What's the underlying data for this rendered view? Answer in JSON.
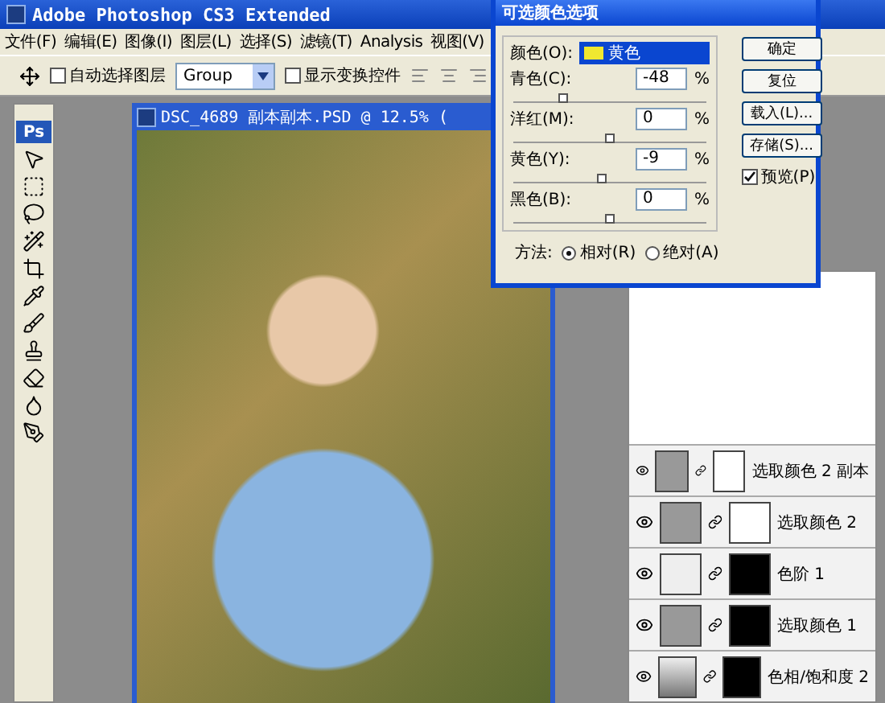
{
  "window": {
    "title": "Adobe Photoshop CS3 Extended"
  },
  "menu": [
    "文件(F)",
    "编辑(E)",
    "图像(I)",
    "图层(L)",
    "选择(S)",
    "滤镜(T)",
    "Analysis",
    "视图(V)"
  ],
  "options_bar": {
    "auto_select": {
      "label": "自动选择图层",
      "checked": false
    },
    "auto_select_target": "Group",
    "show_transform": {
      "label": "显示变换控件",
      "checked": false
    }
  },
  "toolbox": {
    "logo": "Ps"
  },
  "document": {
    "title": "DSC_4689 副本副本.PSD @ 12.5% ("
  },
  "layers": [
    {
      "name": "选取颜色 2 副本",
      "kind": "selective-color",
      "color": "#ffffff"
    },
    {
      "name": "选取颜色 2",
      "kind": "selective-color",
      "color": "#ffffff"
    },
    {
      "name": "色阶 1",
      "kind": "levels",
      "color": "#000000"
    },
    {
      "name": "选取颜色 1",
      "kind": "selective-color",
      "color": "#000000"
    },
    {
      "name": "色相/饱和度 2",
      "kind": "hue-saturation",
      "color": "#000000"
    }
  ],
  "dialog": {
    "title": "可选颜色选项",
    "color_label": "颜色(O):",
    "color_value": "黄色",
    "color": "#f0e830",
    "sliders": [
      {
        "label": "青色(C):",
        "value": "-48",
        "unit": "%",
        "level": 0.26
      },
      {
        "label": "洋红(M):",
        "value": "0",
        "unit": "%",
        "level": 0.5
      },
      {
        "label": "黄色(Y):",
        "value": "-9",
        "unit": "%",
        "level": 0.455
      },
      {
        "label": "黑色(B):",
        "value": "0",
        "unit": "%",
        "level": 0.5
      }
    ],
    "buttons": [
      "确定",
      "复位",
      "载入(L)...",
      "存储(S)..."
    ],
    "preview": {
      "label": "预览(P)",
      "checked": true
    },
    "method_label": "方法:",
    "methods": [
      {
        "label": "相对(R)",
        "selected": true
      },
      {
        "label": "绝对(A)",
        "selected": false
      }
    ]
  }
}
